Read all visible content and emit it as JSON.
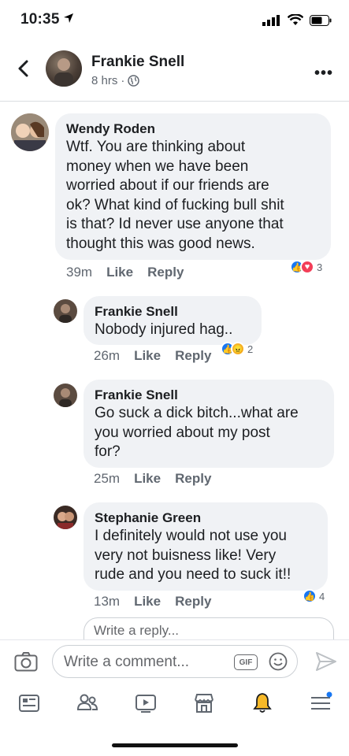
{
  "status_bar": {
    "time": "10:35"
  },
  "post_header": {
    "name": "Frankie Snell",
    "time": "8 hrs",
    "separator": "·"
  },
  "comments": [
    {
      "name": "Wendy Roden",
      "text": "Wtf.  You are thinking about\nmoney when we have been\nworried about if our friends are\nok?  What kind of fucking bull shit\nis that?  Id never use anyone that\nthought this was good news.",
      "time": "39m",
      "like": "Like",
      "reply": "Reply",
      "reaction_count": "3"
    },
    {
      "name": "Frankie Snell",
      "text": "Nobody injured hag..",
      "time": "26m",
      "like": "Like",
      "reply": "Reply",
      "reaction_count": "2"
    },
    {
      "name": "Frankie Snell",
      "text": "Go suck a dick bitch...what are\nyou worried about my post\nfor?",
      "time": "25m",
      "like": "Like",
      "reply": "Reply"
    },
    {
      "name": "Stephanie Green",
      "text": "I definitely would not use you\nvery not buisness like! Very\nrude and you need to suck it!!",
      "time": "13m",
      "like": "Like",
      "reply": "Reply",
      "reaction_count": "4"
    }
  ],
  "reply_box": {
    "placeholder": "Write a reply..."
  },
  "composer": {
    "placeholder": "Write a comment...",
    "gif_label": "GIF"
  },
  "colors": {
    "accent": "#1877f2",
    "bubble": "#f0f2f5",
    "love": "#f33e58",
    "angry": "#f7b125"
  }
}
